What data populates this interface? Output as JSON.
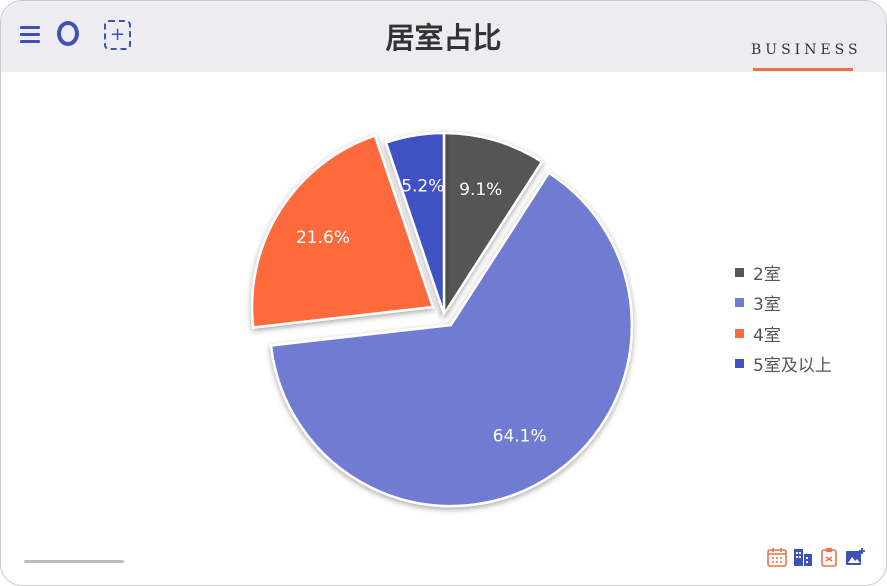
{
  "header": {
    "title": "居室占比",
    "brand": "BUSINESS"
  },
  "icons": {
    "menu": "menu-icon",
    "circle": "circle-icon",
    "add": "add-icon",
    "toolbar": [
      "calendar-icon",
      "building-icon",
      "clipboard-icon",
      "image-add-icon"
    ]
  },
  "colors": {
    "accent": "#3f51b5",
    "brand_line": "#e8734b"
  },
  "chart_data": {
    "type": "pie",
    "title": "居室占比",
    "start_angle_deg": 0,
    "direction": "clockwise",
    "exploded": [
      "3室",
      "4室"
    ],
    "categories": [
      "2室",
      "3室",
      "4室",
      "5室及以上"
    ],
    "values": [
      9.1,
      64.1,
      21.6,
      5.2
    ],
    "labels": [
      "9.1%",
      "64.1%",
      "21.6%",
      "5.2%"
    ],
    "colors": [
      "#555555",
      "#6f7bd1",
      "#ff6b3d",
      "#3f51c4"
    ],
    "legend_position": "right"
  }
}
